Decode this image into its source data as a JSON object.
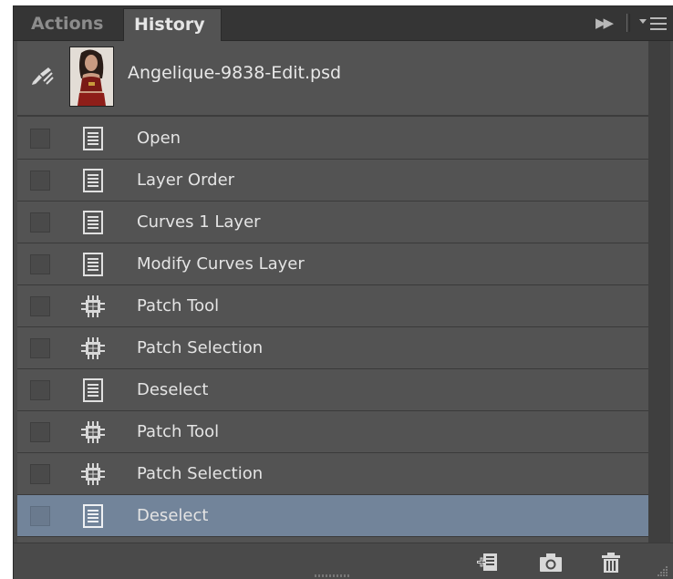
{
  "tabs": [
    {
      "label": "Actions",
      "active": false
    },
    {
      "label": "History",
      "active": true
    }
  ],
  "panel_controls": {
    "collapse_icon": "double-arrow-right-icon",
    "menu_icon": "panel-menu-icon"
  },
  "snapshot": {
    "label": "Angelique-9838-Edit.psd",
    "brush_icon": "history-brush-icon"
  },
  "history_items": [
    {
      "label": "Open",
      "icon": "document-icon",
      "selected": false
    },
    {
      "label": "Layer Order",
      "icon": "document-icon",
      "selected": false
    },
    {
      "label": "Curves 1 Layer",
      "icon": "document-icon",
      "selected": false
    },
    {
      "label": "Modify Curves Layer",
      "icon": "document-icon",
      "selected": false
    },
    {
      "label": "Patch Tool",
      "icon": "patch-icon",
      "selected": false
    },
    {
      "label": "Patch Selection",
      "icon": "patch-icon",
      "selected": false
    },
    {
      "label": "Deselect",
      "icon": "document-icon",
      "selected": false
    },
    {
      "label": "Patch Tool",
      "icon": "patch-icon",
      "selected": false
    },
    {
      "label": "Patch Selection",
      "icon": "patch-icon",
      "selected": false
    },
    {
      "label": "Deselect",
      "icon": "document-icon",
      "selected": true
    }
  ],
  "bottom_toolbar": {
    "buttons": [
      {
        "icon": "new-document-from-state-icon"
      },
      {
        "icon": "camera-icon"
      },
      {
        "icon": "trash-icon"
      }
    ]
  },
  "colors": {
    "panel_bg": "#535353",
    "selected_row": "#72849a",
    "text": "#e4e4e4"
  }
}
